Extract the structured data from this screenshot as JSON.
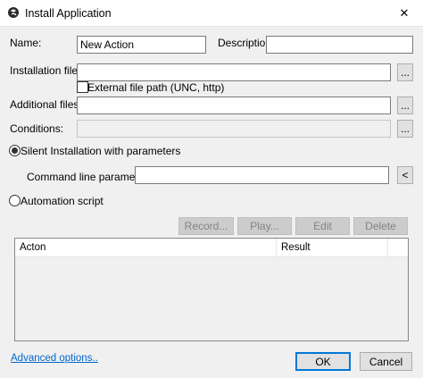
{
  "window": {
    "title": "Install Application",
    "close_glyph": "✕",
    "icon": "app-logo-icon"
  },
  "form": {
    "name_label": "Name:",
    "name_value": "New Action",
    "description_label": "Description:",
    "description_value": "",
    "installation_file_label": "Installation file:",
    "installation_file_value": "",
    "browse_label": "...",
    "external_path_label": "External file path (UNC, http)",
    "external_path_checked": false,
    "additional_files_label": "Additional files:",
    "additional_files_value": "",
    "conditions_label": "Conditions:",
    "conditions_value": ""
  },
  "options": {
    "silent_label": "Silent Installation with parameters",
    "silent_selected": true,
    "cmd_params_label": "Command line parameters:",
    "cmd_params_value": "",
    "cmd_params_button": "<",
    "automation_label": "Automation script",
    "automation_selected": false
  },
  "script_toolbar": {
    "record": "Record...",
    "play": "Play...",
    "edit": "Edit",
    "delete": "Delete"
  },
  "table": {
    "columns": [
      "Acton",
      "Result"
    ],
    "rows": []
  },
  "footer": {
    "advanced_link": "Advanced options..",
    "ok": "OK",
    "cancel": "Cancel"
  }
}
